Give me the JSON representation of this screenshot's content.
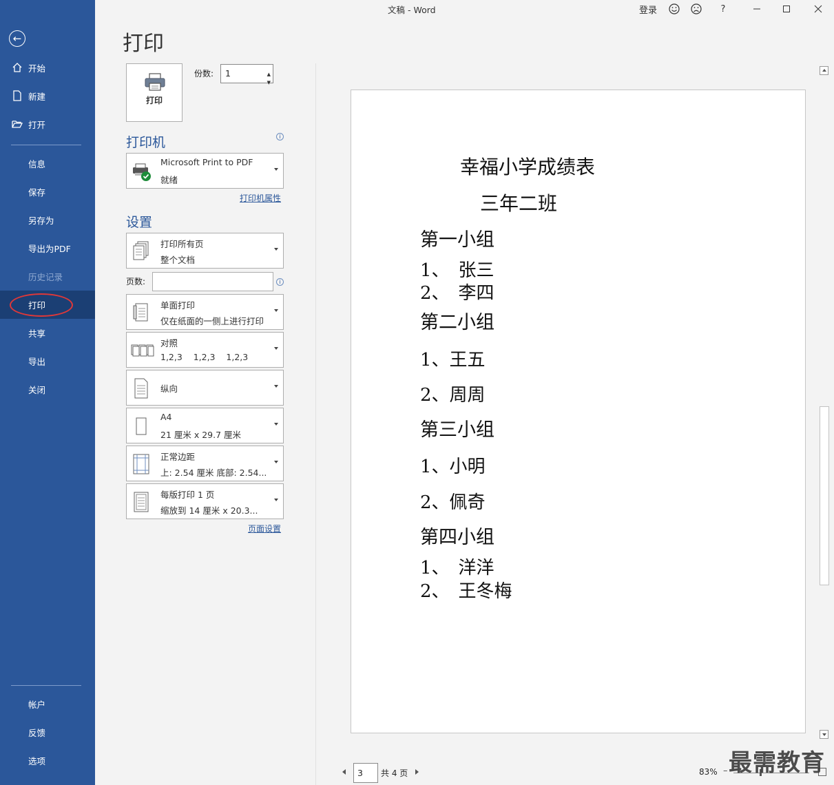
{
  "window": {
    "title": "文稿 - Word",
    "signin": "登录",
    "help": "?"
  },
  "sidebar": {
    "items": [
      {
        "label": "开始"
      },
      {
        "label": "新建"
      },
      {
        "label": "打开"
      },
      {
        "label": "信息"
      },
      {
        "label": "保存"
      },
      {
        "label": "另存为"
      },
      {
        "label": "导出为PDF"
      },
      {
        "label": "历史记录"
      },
      {
        "label": "打印"
      },
      {
        "label": "共享"
      },
      {
        "label": "导出"
      },
      {
        "label": "关闭"
      }
    ],
    "bottom": [
      {
        "label": "帐户"
      },
      {
        "label": "反馈"
      },
      {
        "label": "选项"
      }
    ]
  },
  "page": {
    "title": "打印"
  },
  "print": {
    "button_label": "打印",
    "copies_label": "份数:",
    "copies_value": "1"
  },
  "printer": {
    "section_title": "打印机",
    "name": "Microsoft Print to PDF",
    "status": "就绪",
    "properties_link": "打印机属性"
  },
  "settings": {
    "section_title": "设置",
    "range": {
      "line1": "打印所有页",
      "line2": "整个文档"
    },
    "pages_label": "页数:",
    "pages_value": "",
    "sides": {
      "line1": "单面打印",
      "line2": "仅在纸面的一侧上进行打印"
    },
    "collate": {
      "line1": "对照",
      "line2": "1,2,3    1,2,3    1,2,3"
    },
    "orientation": {
      "line1": "纵向"
    },
    "paper": {
      "line1": "A4",
      "line2": "21 厘米 x 29.7 厘米"
    },
    "margins": {
      "line1": "正常边距",
      "line2": "上: 2.54 厘米 底部: 2.54..."
    },
    "per_sheet": {
      "line1": "每版打印 1 页",
      "line2": "缩放到 14 厘米 x 20.3..."
    },
    "page_setup_link": "页面设置"
  },
  "document": {
    "title": "幸福小学成绩表",
    "subtitle": "三年二班",
    "groups": [
      {
        "heading": "第一小组",
        "members": [
          "1、　张三",
          "2、　李四"
        ]
      },
      {
        "heading": "第二小组",
        "members": [
          "1、王五",
          "2、周周"
        ]
      },
      {
        "heading": "第三小组",
        "members": [
          "1、小明",
          "2、佩奇"
        ]
      },
      {
        "heading": "第四小组",
        "members": [
          "1、　洋洋",
          "2、　王冬梅"
        ]
      }
    ]
  },
  "footer": {
    "current_page": "3",
    "total_pages": "共 4 页",
    "zoom": "83%"
  },
  "watermark": "最需教育",
  "colors": {
    "sidebar": "#2b579a",
    "sidebar_active": "#1b3f74",
    "accent": "#2b579a",
    "highlight_circle": "#e03838"
  }
}
